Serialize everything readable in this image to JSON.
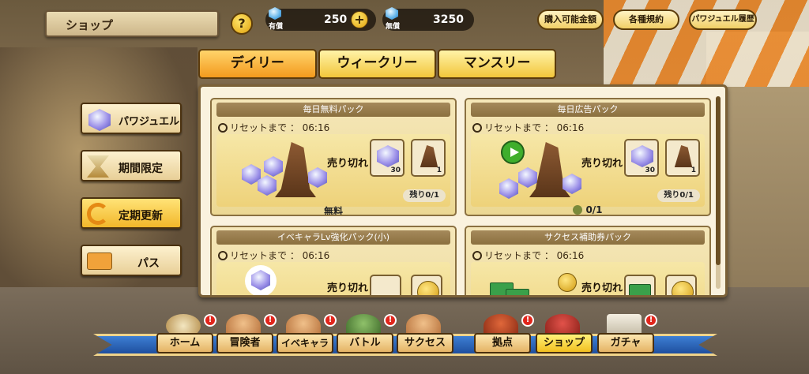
{
  "header": {
    "title": "ショップ",
    "help_label": "?"
  },
  "currency": {
    "paid": {
      "label": "有償",
      "value": "250"
    },
    "free": {
      "label": "無償",
      "value": "3250"
    },
    "add_label": "+"
  },
  "top_buttons": [
    "購入可能金額",
    "各種規約",
    "パワジュエル履歴"
  ],
  "tabs": [
    {
      "label": "デイリー",
      "active": true
    },
    {
      "label": "ウィークリー",
      "active": false
    },
    {
      "label": "マンスリー",
      "active": false
    }
  ],
  "sidebar": [
    {
      "label": "パワジュエル",
      "icon": "gem-icon",
      "active": false
    },
    {
      "label": "期間限定",
      "icon": "hourglass-icon",
      "active": false
    },
    {
      "label": "定期更新",
      "icon": "refresh-icon",
      "active": true
    },
    {
      "label": "パス",
      "icon": "pass-ticket-icon",
      "active": false
    }
  ],
  "cards": [
    {
      "title": "毎日無料パック",
      "reset": "リセットまで ： 06:16",
      "status": "売り切れ",
      "items": [
        {
          "icon": "gem-icon",
          "count": "30"
        },
        {
          "icon": "hat-icon",
          "count": "1"
        }
      ],
      "remaining": "残り0/1",
      "price": "無料"
    },
    {
      "title": "毎日広告パック",
      "reset": "リセットまで ： 06:16",
      "status": "売り切れ",
      "items": [
        {
          "icon": "gem-icon",
          "count": "30"
        },
        {
          "icon": "hat-icon",
          "count": "1"
        }
      ],
      "remaining": "残り0/1",
      "price": "0/1"
    },
    {
      "title": "イベキャラLv強化パック(小)",
      "reset": "リセットまで ： 06:16",
      "status": "売り切れ"
    },
    {
      "title": "サクセス補助券パック",
      "reset": "リセットまで ： 06:16",
      "status": "売り切れ"
    }
  ],
  "bottom_nav": [
    {
      "label": "ホーム",
      "badge": "!",
      "active": false
    },
    {
      "label": "冒険者",
      "badge": "!",
      "active": false
    },
    {
      "label": "イベキャラ",
      "badge": "!",
      "active": false
    },
    {
      "label": "バトル",
      "badge": "!",
      "active": false
    },
    {
      "label": "サクセス",
      "badge": "",
      "active": false
    },
    {
      "label": "拠点",
      "badge": "!",
      "active": false
    },
    {
      "label": "ショップ",
      "badge": "",
      "active": true
    },
    {
      "label": "ガチャ",
      "badge": "!",
      "active": false
    }
  ],
  "colors": {
    "accent": "#f2bf1f",
    "active_tab": "#f39a1d",
    "badge": "#e1261c"
  }
}
